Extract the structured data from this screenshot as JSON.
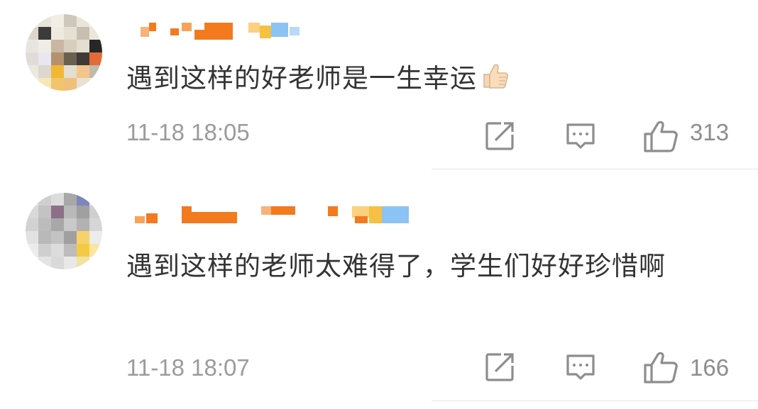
{
  "comments": [
    {
      "username": "",
      "text": "遇到这样的好老师是一生幸运",
      "emoji": "thumbs-up-emoji",
      "timestamp": "11-18 18:05",
      "likes": "313",
      "avatar_colors": [
        "#f4f0e6",
        "#e9e5da",
        "#dcd7ca",
        "#c8bfb0",
        "#6a6050",
        "#b4916f",
        "#e8e4df",
        "#cfc7bc",
        "#e36b3a",
        "#f2b733",
        "#272727",
        "#c0b9ad"
      ],
      "username_colors": [
        "#f47a1f",
        "#f47a1f",
        "#fbd07f",
        "#8bc3f5"
      ]
    },
    {
      "username": "",
      "text": "遇到这样的老师太难得了，学生们好好珍惜啊",
      "timestamp": "11-18 18:07",
      "likes": "166",
      "avatar_colors": [
        "#e4e4e4",
        "#cfcfcf",
        "#b9b9b9",
        "#a8a8a8",
        "#8d6f88",
        "#7c87bb",
        "#dcdcdc",
        "#c3c3c3",
        "#f5d36a",
        "#f4ca45",
        "#a0a0a0",
        "#bcbcbc"
      ],
      "username_colors": [
        "#f47a1f",
        "#f47a1f",
        "#f47a1f",
        "#f47a1f",
        "#fbd07f",
        "#8bc3f5"
      ]
    }
  ],
  "colors": {
    "text": "#333333",
    "meta": "#9b9b9b",
    "icon": "#8d8d8d",
    "divider": "#e6e6e6"
  }
}
